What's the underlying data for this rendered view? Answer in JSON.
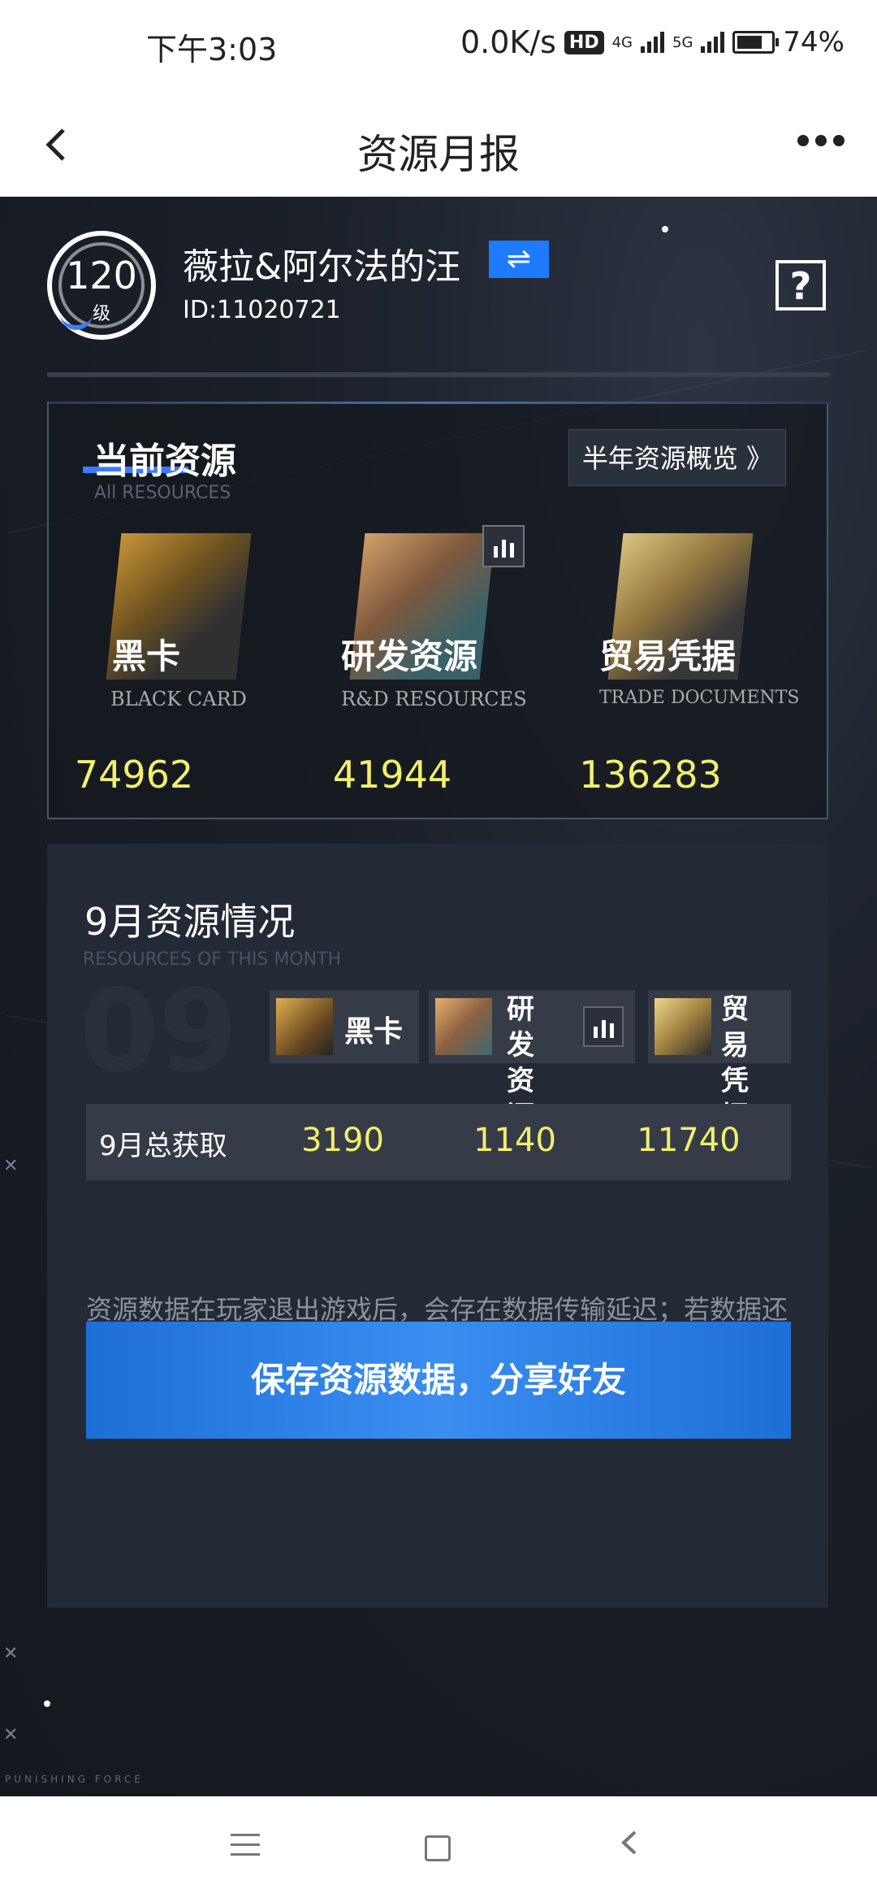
{
  "status_bar": {
    "time": "下午3:03",
    "net_speed": "0.0K/s",
    "hd_badge": "HD",
    "net1": "4G",
    "net2": "5G",
    "battery": "74%"
  },
  "header": {
    "title": "资源月报",
    "back_icon": "chevron-left-icon",
    "more_icon": "more-dots-icon"
  },
  "profile": {
    "level": "120",
    "level_unit": "级",
    "name": "薇拉&阿尔法的汪",
    "switch_icon": "⇌",
    "id": "ID:11020721",
    "help_icon": "?"
  },
  "current": {
    "title": "当前资源",
    "subtitle": "All RESOURCES",
    "overview_button": "半年资源概览 》",
    "resources": [
      {
        "name": "黑卡",
        "en": "BLACK CARD",
        "value": "74962"
      },
      {
        "name": "研发资源",
        "en": "R&D RESOURCES",
        "value": "41944"
      },
      {
        "name": "贸易凭据",
        "en": "TRADE DOCUMENTS",
        "value": "136283"
      }
    ]
  },
  "month": {
    "title": "9月资源情况",
    "subtitle": "RESOURCES OF THIS MONTH",
    "big_number": "09",
    "chips": [
      {
        "label": "黑卡"
      },
      {
        "label": "研发资源",
        "line1": "研发",
        "line2": "资源"
      },
      {
        "label": "贸易凭据",
        "line1": "贸易",
        "line2": "凭据"
      }
    ],
    "total_label": "9月总获取",
    "totals": [
      "3190",
      "1140",
      "11740"
    ],
    "note": "资源数据在玩家退出游戏后，会存在数据传输延迟；若数据还未更新，请稍后再来查询。",
    "save_button": "保存资源数据，分享好友"
  },
  "branding": {
    "logo_text": "PUNISHING FORCE"
  },
  "colors": {
    "accent_yellow": "#f3ef6a",
    "accent_blue": "#1e7bff"
  }
}
